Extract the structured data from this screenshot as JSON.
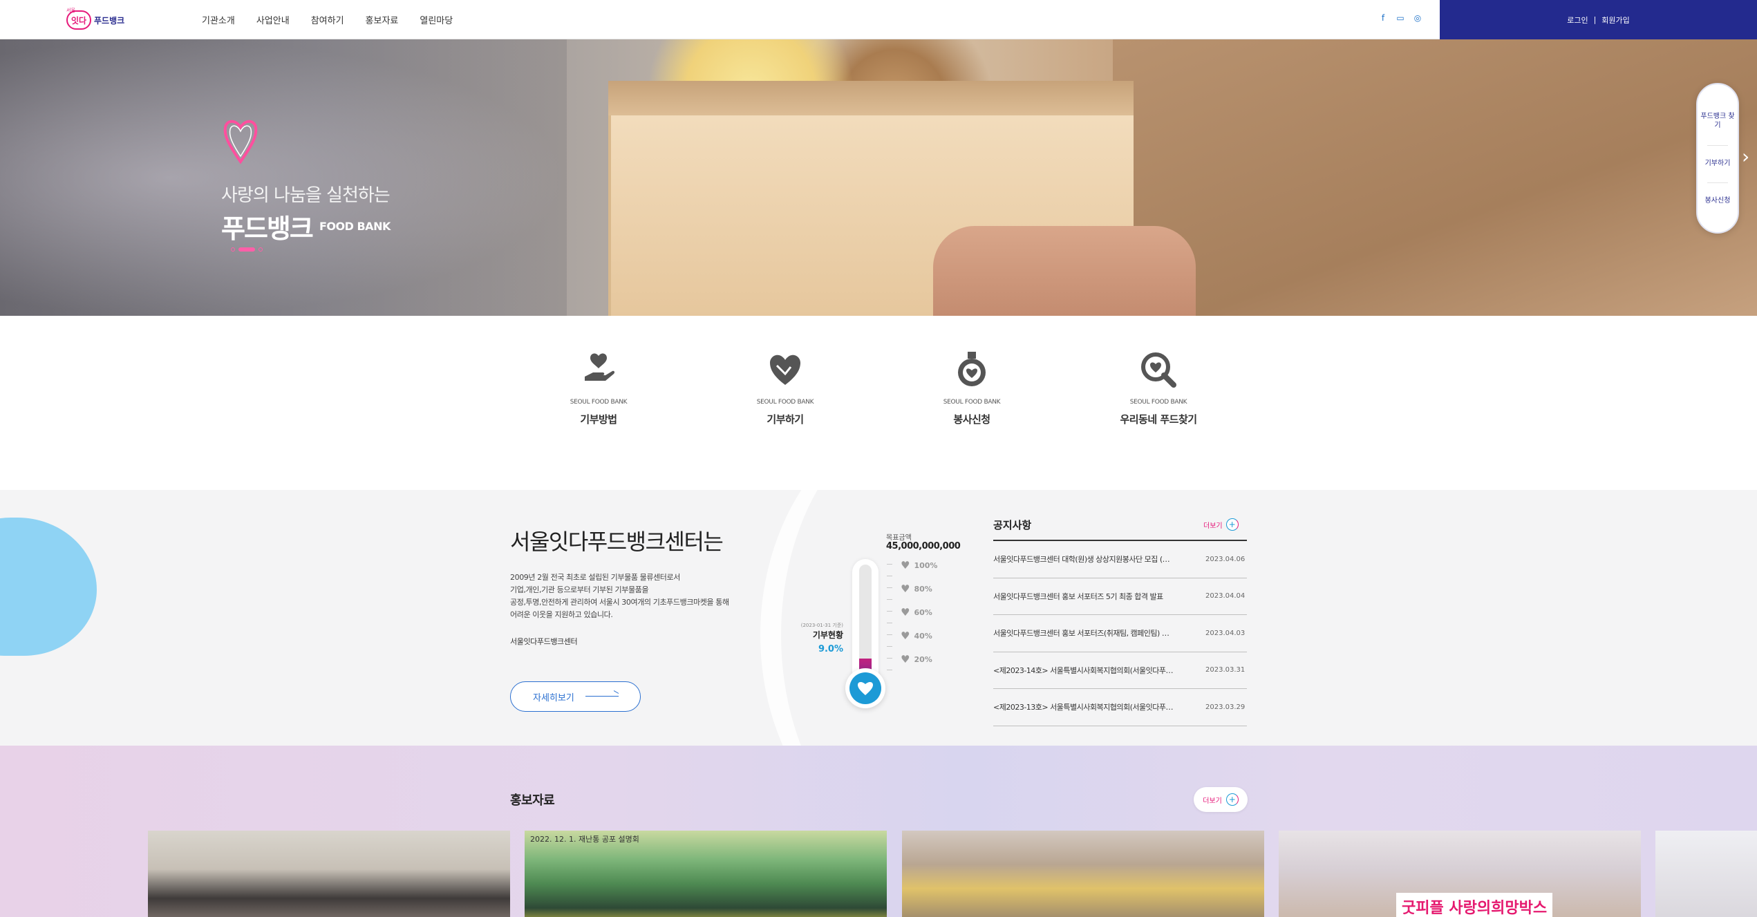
{
  "header": {
    "logo": {
      "small": "서울",
      "mark": "잇다",
      "text": "푸드뱅크"
    },
    "nav": [
      "기관소개",
      "사업안내",
      "참여하기",
      "홍보자료",
      "열린마당"
    ],
    "social_icons": [
      "facebook-icon",
      "blog-icon",
      "instagram-icon"
    ],
    "login": "로그인",
    "separator": "|",
    "signup": "회원가입",
    "colors": {
      "login_bar": "#232a8e",
      "accent_pink": "#e6197a",
      "accent_blue": "#1c9ad6"
    }
  },
  "hero": {
    "subtitle": "사랑의 나눔을 실천하는",
    "title": "푸드뱅크",
    "title_en": "FOOD BANK"
  },
  "quick_side": {
    "items": [
      "푸드뱅크 찾기",
      "기부하기",
      "봉사신청"
    ]
  },
  "quick_menu": [
    {
      "en": "SEOUL FOOD BANK",
      "label": "기부방법",
      "icon": "hand-heart-icon"
    },
    {
      "en": "SEOUL FOOD BANK",
      "label": "기부하기",
      "icon": "heart-hand-icon"
    },
    {
      "en": "SEOUL FOOD BANK",
      "label": "봉사신청",
      "icon": "medal-icon"
    },
    {
      "en": "SEOUL FOOD BANK",
      "label": "우리동네 푸드찾기",
      "icon": "search-heart-icon"
    }
  ],
  "intro": {
    "title": "서울잇다푸드뱅크센터는",
    "desc": [
      "2009년 2월 전국 최초로 설립된 기부물품 물류센터로서",
      "기업,개인,기관 등으로부터 기부된 기부물품을",
      "공정,투명,안전하게 관리하여 서울시 30여개의 기초푸드뱅크마켓을 통해",
      "어려운 이웃을 지원하고 있습니다."
    ],
    "org": "서울잇다푸드뱅크센터",
    "more": "자세히보기"
  },
  "thermometer": {
    "goal_label": "목표금액",
    "goal_amount": "45,000,000,000",
    "date": "(2023-01-31 기준)",
    "label": "기부현황",
    "percent": "9.0%",
    "progress": 0.09,
    "scale": [
      "100%",
      "80%",
      "60%",
      "40%",
      "20%"
    ]
  },
  "notice": {
    "title": "공지사항",
    "more": "더보기",
    "items": [
      {
        "title": "서울잇다푸드뱅크센터 대학(원)생 상상지원봉사단 모집 (…",
        "date": "2023.04.06"
      },
      {
        "title": "서울잇다푸드뱅크센터 홍보 서포터즈 5기 최종 합격 발표",
        "date": "2023.04.04"
      },
      {
        "title": "서울잇다푸드뱅크센터 홍보 서포터즈(취재팀, 캠페인팀) …",
        "date": "2023.04.03"
      },
      {
        "title": "<제2023-14호> 서울특별시사회복지협의회(서울잇다푸…",
        "date": "2023.03.31"
      },
      {
        "title": "<제2023-13호> 서울특별시사회복지협의회(서울잇다푸…",
        "date": "2023.03.29"
      }
    ]
  },
  "pr": {
    "title": "홍보자료",
    "more": "더보기",
    "cards": [
      {
        "caption": ""
      },
      {
        "caption": "2022. 12. 1.   재난통 공포 설명회"
      },
      {
        "caption": ""
      },
      {
        "caption": "굿피플 사랑의희망박스"
      },
      {
        "caption": ""
      }
    ]
  }
}
